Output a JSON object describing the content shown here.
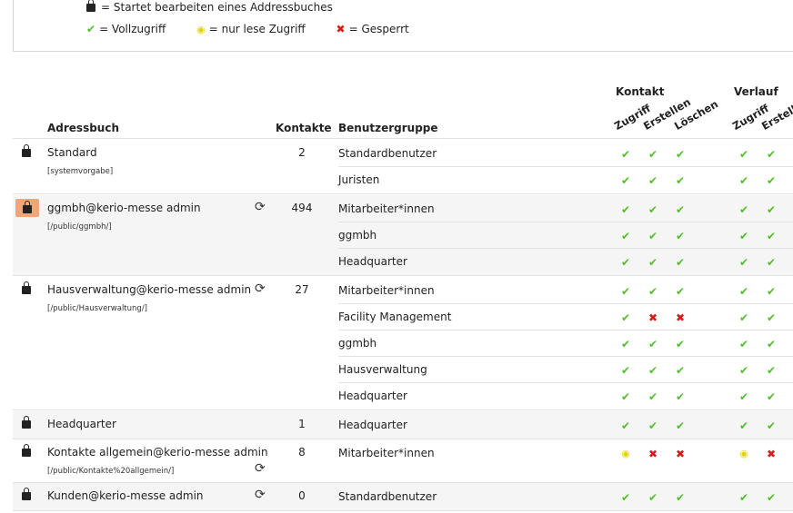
{
  "legend": {
    "lock_text": "= Startet bearbeiten eines Addressbuches",
    "full_text": "= Vollzugriff",
    "read_text": "= nur lese Zugriff",
    "blocked_text": "= Gesperrt",
    "full_symbol": "✔",
    "read_symbol": "◉",
    "blocked_symbol": "✖"
  },
  "table": {
    "headers": {
      "addressbook": "Adressbuch",
      "contacts": "Kontakte",
      "usergroup": "Benutzergruppe",
      "group_kontakt": "Kontakt",
      "group_verlauf": "Verlauf",
      "zugriff": "Zugriff",
      "erstellen": "Erstellen",
      "loeschen": "Löschen",
      "zugriff2": "Zugriff",
      "erstellen2": "Erstellen"
    },
    "sync_symbol": "⟳",
    "addressbooks": [
      {
        "name": "Standard",
        "path": "[systemvorgabe]",
        "count": "2",
        "groups": [
          {
            "name": "Standardbenutzer",
            "k": [
              "full",
              "full",
              "full"
            ],
            "v": [
              "full",
              "full"
            ]
          },
          {
            "name": "Juristen",
            "k": [
              "full",
              "full",
              "full"
            ],
            "v": [
              "full",
              "full"
            ]
          }
        ]
      },
      {
        "name": "ggmbh@kerio-messe admin",
        "path": "[/public/ggmbh/]",
        "count": "494",
        "groups": [
          {
            "name": "Mitarbeiter*innen",
            "k": [
              "full",
              "full",
              "full"
            ],
            "v": [
              "full",
              "full"
            ]
          },
          {
            "name": "ggmbh",
            "k": [
              "full",
              "full",
              "full"
            ],
            "v": [
              "full",
              "full"
            ]
          },
          {
            "name": "Headquarter",
            "k": [
              "full",
              "full",
              "full"
            ],
            "v": [
              "full",
              "full"
            ]
          }
        ]
      },
      {
        "name": "Hausverwaltung@kerio-messe admin",
        "path": "[/public/Hausverwaltung/]",
        "count": "27",
        "groups": [
          {
            "name": "Mitarbeiter*innen",
            "k": [
              "full",
              "full",
              "full"
            ],
            "v": [
              "full",
              "full"
            ]
          },
          {
            "name": "Facility Management",
            "k": [
              "full",
              "blocked",
              "blocked"
            ],
            "v": [
              "full",
              "full"
            ]
          },
          {
            "name": "ggmbh",
            "k": [
              "full",
              "full",
              "full"
            ],
            "v": [
              "full",
              "full"
            ]
          },
          {
            "name": "Hausverwaltung",
            "k": [
              "full",
              "full",
              "full"
            ],
            "v": [
              "full",
              "full"
            ]
          },
          {
            "name": "Headquarter",
            "k": [
              "full",
              "full",
              "full"
            ],
            "v": [
              "full",
              "full"
            ]
          }
        ]
      },
      {
        "name": "Headquarter",
        "path": "",
        "count": "1",
        "groups": [
          {
            "name": "Headquarter",
            "k": [
              "full",
              "full",
              "full"
            ],
            "v": [
              "full",
              "full"
            ]
          }
        ]
      },
      {
        "name": "Kontakte allgemein@kerio-messe admin",
        "path": "[/public/Kontakte%20allgemein/]",
        "count": "8",
        "groups": [
          {
            "name": "Mitarbeiter*innen",
            "k": [
              "read",
              "blocked",
              "blocked"
            ],
            "v": [
              "read",
              "blocked"
            ]
          }
        ]
      },
      {
        "name": "Kunden@kerio-messe admin",
        "path": "",
        "count": "0",
        "groups": [
          {
            "name": "Standardbenutzer",
            "k": [
              "full",
              "full",
              "full"
            ],
            "v": [
              "full",
              "full"
            ]
          }
        ]
      }
    ]
  }
}
